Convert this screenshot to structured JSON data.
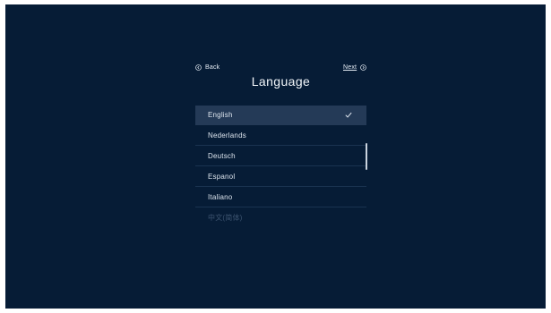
{
  "nav": {
    "back_label": "Back",
    "next_label": "Next"
  },
  "page": {
    "title": "Language"
  },
  "languages": [
    {
      "label": "English",
      "selected": true
    },
    {
      "label": "Nederlands",
      "selected": false
    },
    {
      "label": "Deutsch",
      "selected": false
    },
    {
      "label": "Espanol",
      "selected": false
    },
    {
      "label": "Italiano",
      "selected": false
    },
    {
      "label": "中文(简体)",
      "selected": false
    }
  ],
  "icons": {
    "back": "circle-chevron-left-icon",
    "next": "circle-chevron-right-icon",
    "selected": "checkmark-icon"
  },
  "colors": {
    "background": "#061c36",
    "selected_row": "#243a57",
    "text": "#dde5ee"
  }
}
